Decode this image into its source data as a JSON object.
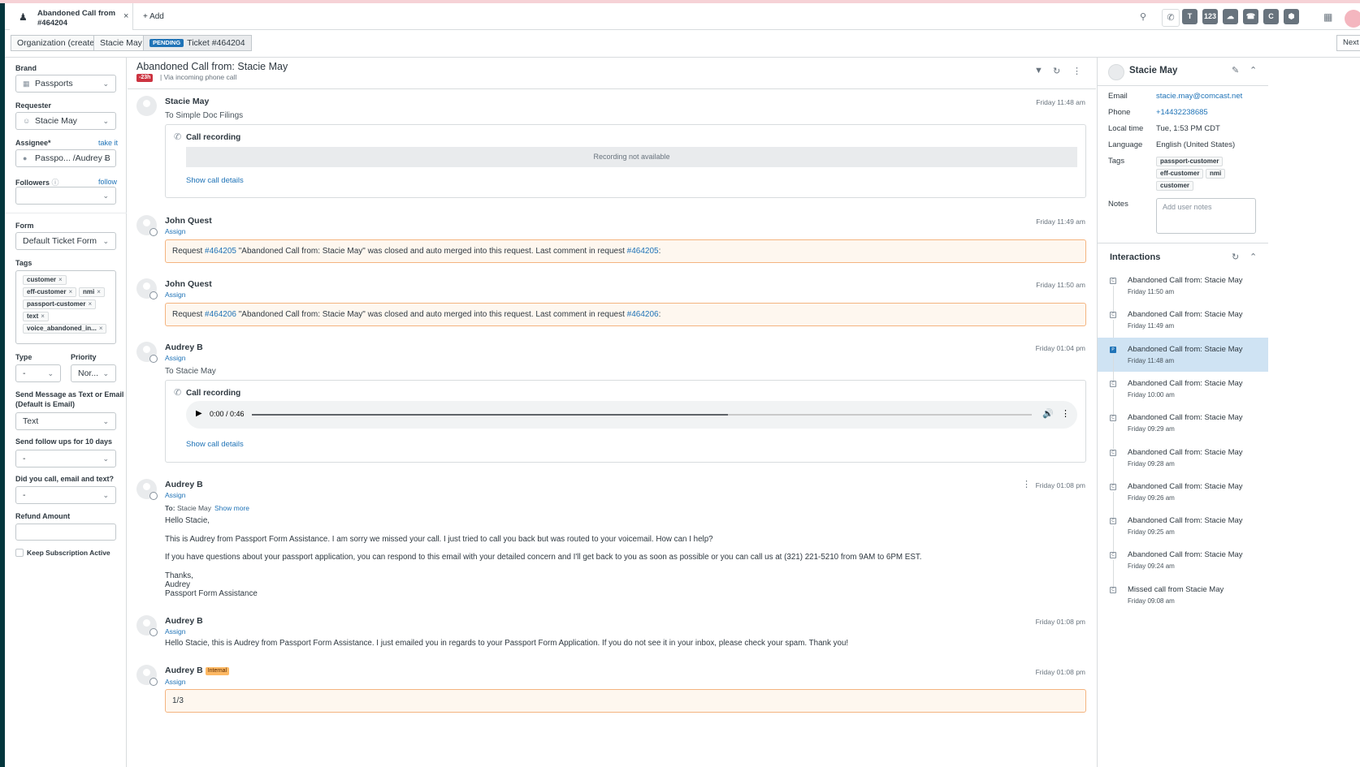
{
  "tabbar": {
    "active_tab_title": "Abandoned Call from: ...",
    "active_tab_id": "#464204",
    "close": "×",
    "add_label": "+ Add",
    "apps": [
      "T",
      "123",
      "☁",
      "☎",
      "C",
      "⬢"
    ]
  },
  "breadcrumbs": {
    "org": "Organization (create)",
    "user": "Stacie May",
    "status_badge": "PENDING",
    "ticket": "Ticket #464204",
    "next": "Next"
  },
  "ticket_fields": {
    "brand_label": "Brand",
    "brand_value": "Passports",
    "requester_label": "Requester",
    "requester_value": "Stacie May",
    "assignee_label": "Assignee*",
    "take_it": "take it",
    "assignee_value": "Passpo... /Audrey B",
    "followers_label": "Followers",
    "follow": "follow",
    "form_label": "Form",
    "form_value": "Default Ticket Form",
    "tags_label": "Tags",
    "tags": [
      "customer",
      "eff-customer",
      "nmi",
      "passport-customer",
      "text",
      "voice_abandoned_in..."
    ],
    "type_label": "Type",
    "type_value": "-",
    "priority_label": "Priority",
    "priority_value": "Nor...",
    "send_msg_label_1": "Send Message as Text or Email",
    "send_msg_label_2": "(Default is Email)",
    "send_msg_value": "Text",
    "followups_label": "Send follow ups for 10 days",
    "followups_value": "-",
    "called_label": "Did you call, email and text?",
    "called_value": "-",
    "refund_label": "Refund Amount",
    "keep_sub_label": "Keep Subscription Active"
  },
  "conversation": {
    "title": "Abandoned Call from: Stacie May",
    "age_badge": "-23h",
    "via": "Via incoming phone call",
    "assign": "Assign",
    "call_recording": "Call recording",
    "recording_not_available": "Recording not available",
    "show_call_details": "Show call details",
    "messages": [
      {
        "author": "Stacie May",
        "time": "Friday 11:48 am",
        "to": "To Simple Doc Filings"
      },
      {
        "author": "John Quest",
        "time": "Friday 11:49 am",
        "pre": "Request ",
        "link1": "#464205",
        "mid": " \"Abandoned Call from: Stacie May\" was closed and auto merged into this request. Last comment in request ",
        "link2": "#464205",
        "post": ":"
      },
      {
        "author": "John Quest",
        "time": "Friday 11:50 am",
        "pre": "Request ",
        "link1": "#464206",
        "mid": " \"Abandoned Call from: Stacie May\" was closed and auto merged into this request. Last comment in request ",
        "link2": "#464206",
        "post": ":"
      },
      {
        "author": "Audrey B",
        "time": "Friday 01:04 pm",
        "to": "To Stacie May",
        "player_time": "0:00 / 0:46",
        "progress": 0.61
      },
      {
        "author": "Audrey B",
        "time": "Friday 01:08 pm",
        "to_label": "To:",
        "to_name": "Stacie May",
        "show_more": "Show more",
        "lines": [
          "Hello Stacie,",
          "This is Audrey from Passport Form Assistance. I am sorry we missed your call. I just tried to call you back but was routed to your voicemail. How can I help?",
          "If you have questions about your passport application, you can respond to this email with your detailed concern and I'll get back to you as soon as possible or you can call us at (321) 221-5210 from 9AM to 6PM EST.",
          "Thanks,",
          "Audrey",
          "Passport Form Assistance"
        ]
      },
      {
        "author": "Audrey B",
        "time": "Friday 01:08 pm",
        "text": "Hello Stacie, this is Audrey from Passport Form Assistance. I just emailed you in regards to your Passport Form Application. If you do not see it in your inbox, please check your spam. Thank you!"
      },
      {
        "author": "Audrey B",
        "badge": "Internal",
        "time": "Friday 01:08 pm",
        "text": "1/3"
      }
    ]
  },
  "customer": {
    "name": "Stacie May",
    "email_label": "Email",
    "email": "stacie.may@comcast.net",
    "phone_label": "Phone",
    "phone": "+14432238685",
    "local_time_label": "Local time",
    "local_time": "Tue, 1:53 PM CDT",
    "language_label": "Language",
    "language": "English (United States)",
    "tags_label": "Tags",
    "tags": [
      "passport-customer",
      "eff-customer",
      "nmi",
      "customer"
    ],
    "notes_label": "Notes",
    "notes_placeholder": "Add user notes"
  },
  "interactions": {
    "title": "Interactions",
    "items": [
      {
        "title": "Abandoned Call from: Stacie May",
        "time": "Friday 11:50 am",
        "type": "C"
      },
      {
        "title": "Abandoned Call from: Stacie May",
        "time": "Friday 11:49 am",
        "type": "C"
      },
      {
        "title": "Abandoned Call from: Stacie May",
        "time": "Friday 11:48 am",
        "type": "P"
      },
      {
        "title": "Abandoned Call from: Stacie May",
        "time": "Friday 10:00 am",
        "type": "C"
      },
      {
        "title": "Abandoned Call from: Stacie May",
        "time": "Friday 09:29 am",
        "type": "C"
      },
      {
        "title": "Abandoned Call from: Stacie May",
        "time": "Friday 09:28 am",
        "type": "C"
      },
      {
        "title": "Abandoned Call from: Stacie May",
        "time": "Friday 09:26 am",
        "type": "C"
      },
      {
        "title": "Abandoned Call from: Stacie May",
        "time": "Friday 09:25 am",
        "type": "C"
      },
      {
        "title": "Abandoned Call from: Stacie May",
        "time": "Friday 09:24 am",
        "type": "C"
      },
      {
        "title": "Missed call from Stacie May",
        "time": "Friday 09:08 am",
        "type": "C"
      }
    ]
  },
  "colors": {
    "accent": "#1f73b7",
    "urgent": "#cc3340",
    "nav": "#03363d",
    "notice_bg": "#fef7ef",
    "notice_border": "#f4b480"
  }
}
